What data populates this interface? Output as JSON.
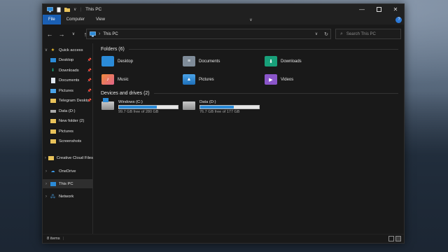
{
  "window": {
    "title": "This PC"
  },
  "ribbon": {
    "tabs": [
      "File",
      "Computer",
      "View"
    ]
  },
  "nav": {
    "address_path": "This PC",
    "search_placeholder": "Search This PC"
  },
  "sidebar": {
    "items": [
      {
        "label": "Quick access",
        "icon": "star-icon",
        "pinned": false,
        "selected": false
      },
      {
        "label": "Desktop",
        "icon": "desktop-icon",
        "pinned": true,
        "selected": false
      },
      {
        "label": "Downloads",
        "icon": "download-icon",
        "pinned": true,
        "selected": false
      },
      {
        "label": "Documents",
        "icon": "documents-icon",
        "pinned": true,
        "selected": false
      },
      {
        "label": "Pictures",
        "icon": "pictures-icon",
        "pinned": true,
        "selected": false
      },
      {
        "label": "Telegram Deskto",
        "icon": "folder-icon",
        "pinned": true,
        "selected": false
      },
      {
        "label": "Data (D:)",
        "icon": "drive-icon",
        "pinned": false,
        "selected": false
      },
      {
        "label": "New folder (2)",
        "icon": "folder-icon",
        "pinned": false,
        "selected": false
      },
      {
        "label": "Pictures",
        "icon": "folder-icon",
        "pinned": false,
        "selected": false
      },
      {
        "label": "Screenshots",
        "icon": "folder-icon",
        "pinned": false,
        "selected": false
      },
      {
        "label": "Creative Cloud Files",
        "icon": "creative-cloud-icon",
        "pinned": false,
        "selected": false
      },
      {
        "label": "OneDrive",
        "icon": "onedrive-icon",
        "pinned": false,
        "selected": false
      },
      {
        "label": "This PC",
        "icon": "this-pc-icon",
        "pinned": false,
        "selected": true
      },
      {
        "label": "Network",
        "icon": "network-icon",
        "pinned": false,
        "selected": false
      }
    ]
  },
  "content": {
    "folders_heading": "Folders (6)",
    "folders": [
      {
        "label": "Desktop",
        "icon": "desktop-folder-icon",
        "color": "#2b8bd8"
      },
      {
        "label": "Documents",
        "icon": "documents-folder-icon",
        "color": "#7f8c99"
      },
      {
        "label": "Downloads",
        "icon": "downloads-folder-icon",
        "color": "#18a07a"
      },
      {
        "label": "Music",
        "icon": "music-folder-icon",
        "color": "#e0648a"
      },
      {
        "label": "Pictures",
        "icon": "pictures-folder-icon",
        "color": "#2b8bd8"
      },
      {
        "label": "Videos",
        "icon": "videos-folder-icon",
        "color": "#8a55c9"
      }
    ],
    "drives_heading": "Devices and drives (2)",
    "drives": [
      {
        "label": "Windows (C:)",
        "free_text": "99.7 GB free of 280 GB",
        "used_fraction": 0.644
      },
      {
        "label": "Data (D:)",
        "free_text": "76.7 GB free of 177 GB",
        "used_fraction": 0.567
      }
    ]
  },
  "status": {
    "items_count": "8 items"
  },
  "colors": {
    "accent": "#1a5fb4",
    "drive_bar": "#2b8bd8"
  }
}
